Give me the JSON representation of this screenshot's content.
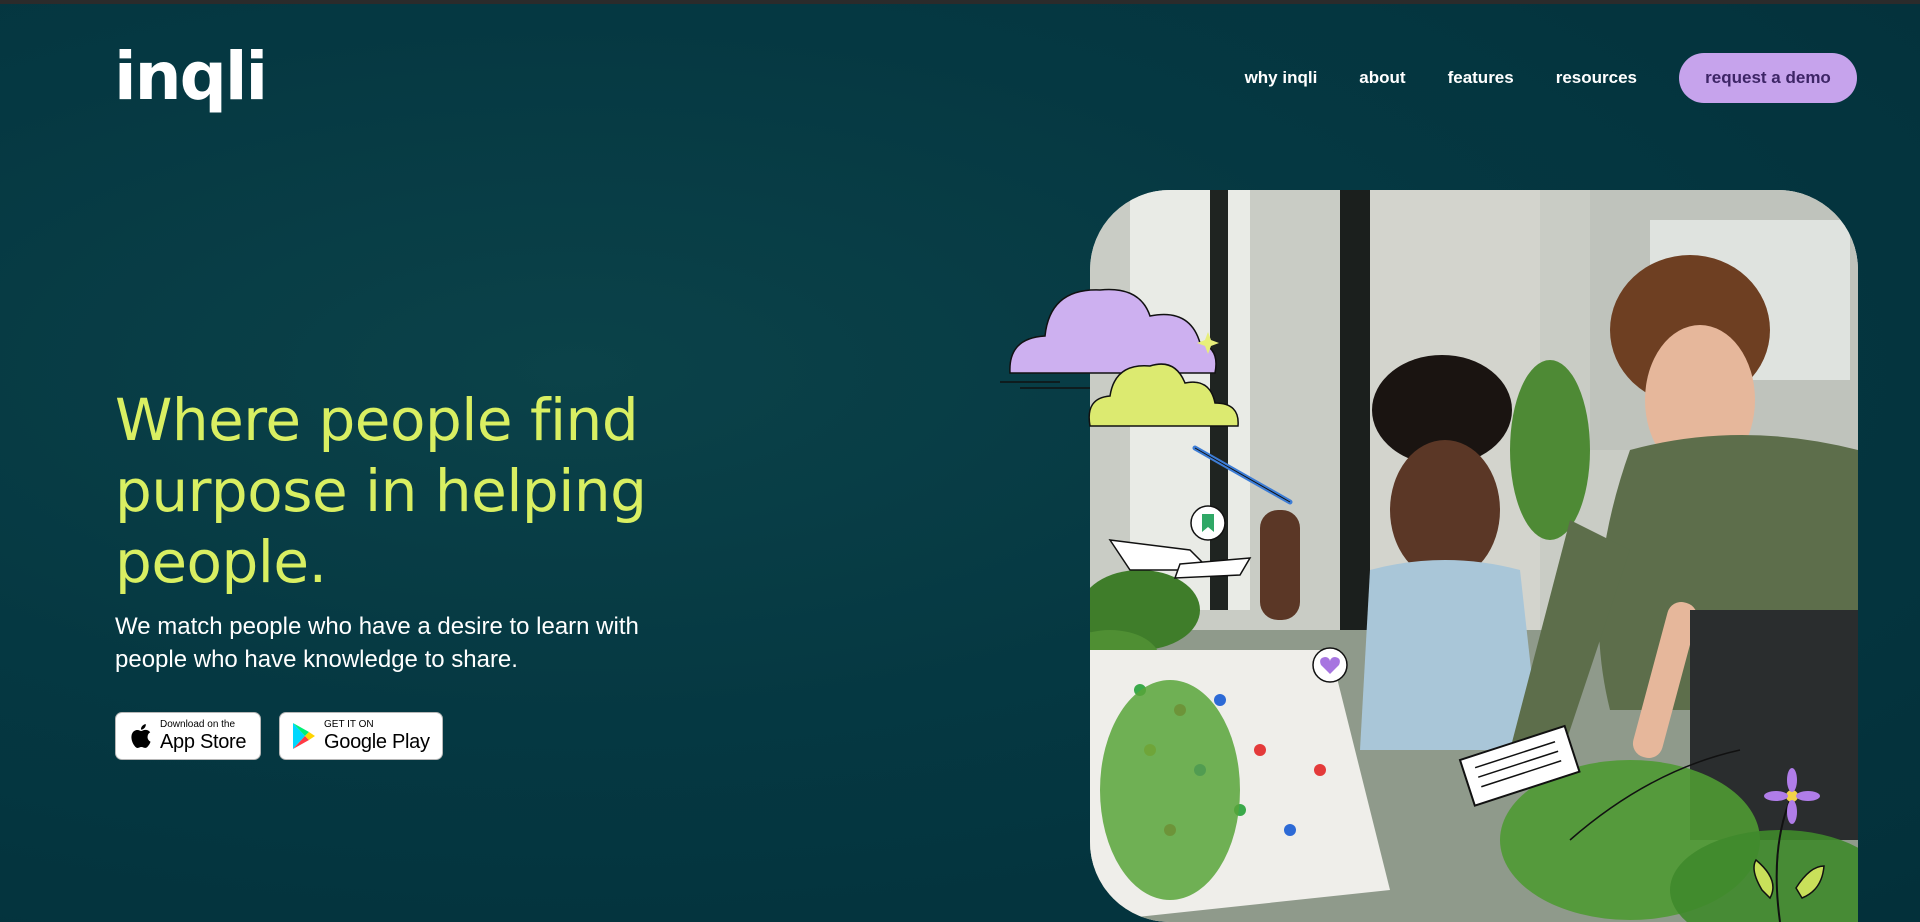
{
  "brand": {
    "logo_text": "inqli"
  },
  "nav": {
    "items": [
      "why inqli",
      "about",
      "features",
      "resources"
    ],
    "cta_label": "request a demo"
  },
  "hero": {
    "headline": "Where people find purpose in helping people.",
    "subtext": "We match people who have a desire to learn with people who have knowledge to share."
  },
  "badges": {
    "apple": {
      "small": "Download on the",
      "big": "App Store"
    },
    "google": {
      "small": "GET IT ON",
      "big": "Google Play"
    }
  },
  "colors": {
    "background": "#053842",
    "headline": "#d9ef62",
    "cta_bg": "#c6a3ec",
    "cta_text": "#3d2566"
  },
  "icons": [
    "apple-icon",
    "google-play-icon",
    "cloud-icon",
    "bookmark-icon",
    "heart-icon",
    "flower-icon",
    "pen-icon"
  ]
}
